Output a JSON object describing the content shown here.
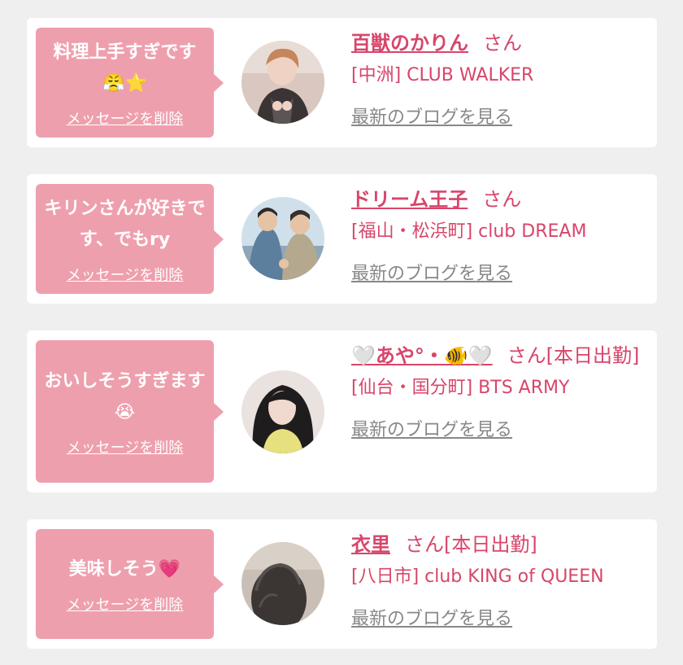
{
  "cards": [
    {
      "message": "料理上手すぎです",
      "message_emoji": "😤⭐",
      "delete_label": "メッセージを削除",
      "name": "百獣のかりん",
      "honorific": "さん",
      "shop": "[中洲] CLUB WALKER",
      "blog_label": "最新のブログを見る"
    },
    {
      "message": "キリンさんが好きです、でもry",
      "delete_label": "メッセージを削除",
      "name": "ドリーム王子",
      "honorific": "さん",
      "shop": "[福山・松浜町]  club DREAM",
      "blog_label": "最新のブログを見る"
    },
    {
      "message": "おいしそうすぎます",
      "message_emoji": "😭",
      "delete_label": "メッセージを削除",
      "name": "🤍あや°・🐠🤍",
      "honorific": "さん[本日出勤]",
      "shop": "[仙台・国分町] BTS ARMY",
      "blog_label": "最新のブログを見る"
    },
    {
      "message": "美味しそう",
      "message_emoji": "💗",
      "delete_label": "メッセージを削除",
      "name": "衣里",
      "honorific": "さん[本日出勤]",
      "shop": "[八日市] club KING of QUEEN",
      "blog_label": "最新のブログを見る"
    }
  ]
}
